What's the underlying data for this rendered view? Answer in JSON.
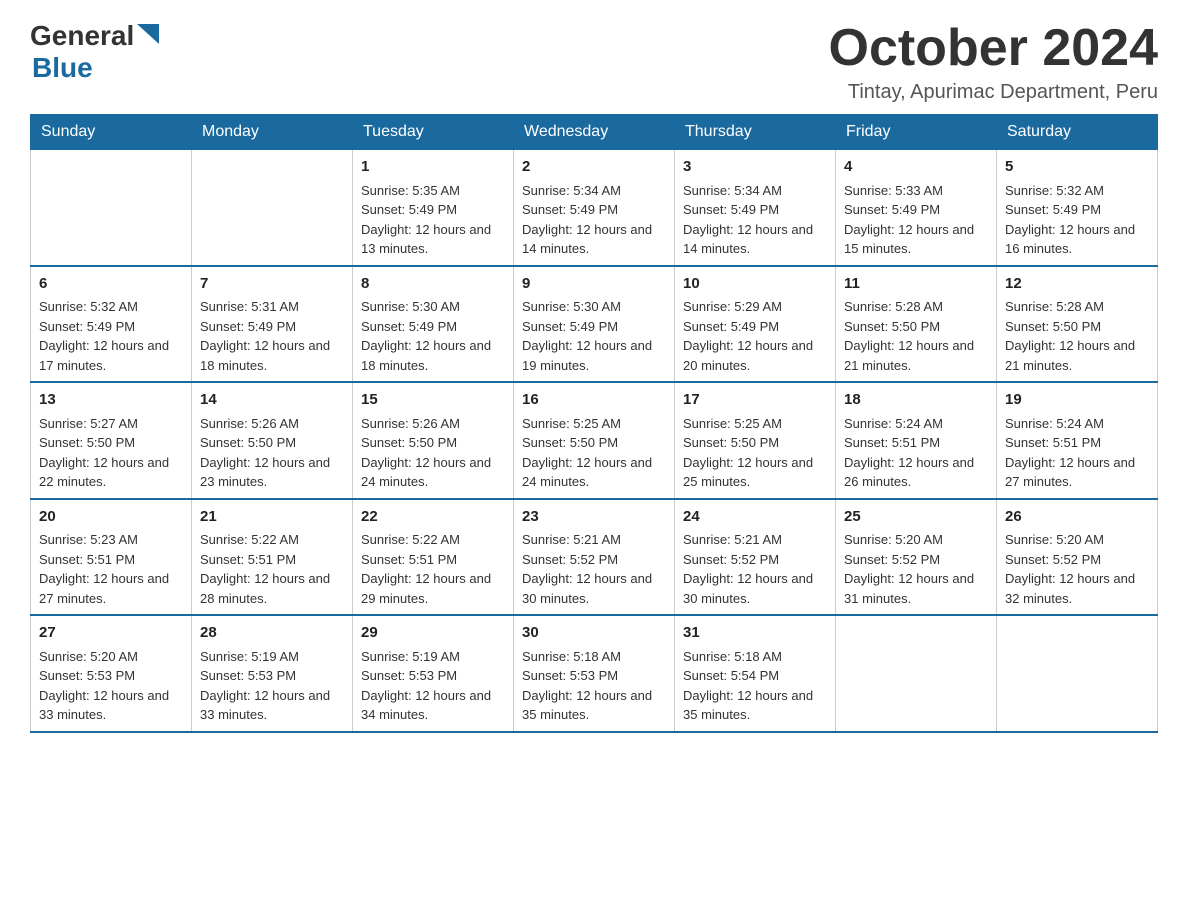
{
  "header": {
    "logo": {
      "general": "General",
      "blue": "Blue"
    },
    "title": "October 2024",
    "subtitle": "Tintay, Apurimac Department, Peru"
  },
  "weekdays": [
    "Sunday",
    "Monday",
    "Tuesday",
    "Wednesday",
    "Thursday",
    "Friday",
    "Saturday"
  ],
  "weeks": [
    [
      {
        "day": "",
        "sunrise": "",
        "sunset": "",
        "daylight": ""
      },
      {
        "day": "",
        "sunrise": "",
        "sunset": "",
        "daylight": ""
      },
      {
        "day": "1",
        "sunrise": "Sunrise: 5:35 AM",
        "sunset": "Sunset: 5:49 PM",
        "daylight": "Daylight: 12 hours and 13 minutes."
      },
      {
        "day": "2",
        "sunrise": "Sunrise: 5:34 AM",
        "sunset": "Sunset: 5:49 PM",
        "daylight": "Daylight: 12 hours and 14 minutes."
      },
      {
        "day": "3",
        "sunrise": "Sunrise: 5:34 AM",
        "sunset": "Sunset: 5:49 PM",
        "daylight": "Daylight: 12 hours and 14 minutes."
      },
      {
        "day": "4",
        "sunrise": "Sunrise: 5:33 AM",
        "sunset": "Sunset: 5:49 PM",
        "daylight": "Daylight: 12 hours and 15 minutes."
      },
      {
        "day": "5",
        "sunrise": "Sunrise: 5:32 AM",
        "sunset": "Sunset: 5:49 PM",
        "daylight": "Daylight: 12 hours and 16 minutes."
      }
    ],
    [
      {
        "day": "6",
        "sunrise": "Sunrise: 5:32 AM",
        "sunset": "Sunset: 5:49 PM",
        "daylight": "Daylight: 12 hours and 17 minutes."
      },
      {
        "day": "7",
        "sunrise": "Sunrise: 5:31 AM",
        "sunset": "Sunset: 5:49 PM",
        "daylight": "Daylight: 12 hours and 18 minutes."
      },
      {
        "day": "8",
        "sunrise": "Sunrise: 5:30 AM",
        "sunset": "Sunset: 5:49 PM",
        "daylight": "Daylight: 12 hours and 18 minutes."
      },
      {
        "day": "9",
        "sunrise": "Sunrise: 5:30 AM",
        "sunset": "Sunset: 5:49 PM",
        "daylight": "Daylight: 12 hours and 19 minutes."
      },
      {
        "day": "10",
        "sunrise": "Sunrise: 5:29 AM",
        "sunset": "Sunset: 5:49 PM",
        "daylight": "Daylight: 12 hours and 20 minutes."
      },
      {
        "day": "11",
        "sunrise": "Sunrise: 5:28 AM",
        "sunset": "Sunset: 5:50 PM",
        "daylight": "Daylight: 12 hours and 21 minutes."
      },
      {
        "day": "12",
        "sunrise": "Sunrise: 5:28 AM",
        "sunset": "Sunset: 5:50 PM",
        "daylight": "Daylight: 12 hours and 21 minutes."
      }
    ],
    [
      {
        "day": "13",
        "sunrise": "Sunrise: 5:27 AM",
        "sunset": "Sunset: 5:50 PM",
        "daylight": "Daylight: 12 hours and 22 minutes."
      },
      {
        "day": "14",
        "sunrise": "Sunrise: 5:26 AM",
        "sunset": "Sunset: 5:50 PM",
        "daylight": "Daylight: 12 hours and 23 minutes."
      },
      {
        "day": "15",
        "sunrise": "Sunrise: 5:26 AM",
        "sunset": "Sunset: 5:50 PM",
        "daylight": "Daylight: 12 hours and 24 minutes."
      },
      {
        "day": "16",
        "sunrise": "Sunrise: 5:25 AM",
        "sunset": "Sunset: 5:50 PM",
        "daylight": "Daylight: 12 hours and 24 minutes."
      },
      {
        "day": "17",
        "sunrise": "Sunrise: 5:25 AM",
        "sunset": "Sunset: 5:50 PM",
        "daylight": "Daylight: 12 hours and 25 minutes."
      },
      {
        "day": "18",
        "sunrise": "Sunrise: 5:24 AM",
        "sunset": "Sunset: 5:51 PM",
        "daylight": "Daylight: 12 hours and 26 minutes."
      },
      {
        "day": "19",
        "sunrise": "Sunrise: 5:24 AM",
        "sunset": "Sunset: 5:51 PM",
        "daylight": "Daylight: 12 hours and 27 minutes."
      }
    ],
    [
      {
        "day": "20",
        "sunrise": "Sunrise: 5:23 AM",
        "sunset": "Sunset: 5:51 PM",
        "daylight": "Daylight: 12 hours and 27 minutes."
      },
      {
        "day": "21",
        "sunrise": "Sunrise: 5:22 AM",
        "sunset": "Sunset: 5:51 PM",
        "daylight": "Daylight: 12 hours and 28 minutes."
      },
      {
        "day": "22",
        "sunrise": "Sunrise: 5:22 AM",
        "sunset": "Sunset: 5:51 PM",
        "daylight": "Daylight: 12 hours and 29 minutes."
      },
      {
        "day": "23",
        "sunrise": "Sunrise: 5:21 AM",
        "sunset": "Sunset: 5:52 PM",
        "daylight": "Daylight: 12 hours and 30 minutes."
      },
      {
        "day": "24",
        "sunrise": "Sunrise: 5:21 AM",
        "sunset": "Sunset: 5:52 PM",
        "daylight": "Daylight: 12 hours and 30 minutes."
      },
      {
        "day": "25",
        "sunrise": "Sunrise: 5:20 AM",
        "sunset": "Sunset: 5:52 PM",
        "daylight": "Daylight: 12 hours and 31 minutes."
      },
      {
        "day": "26",
        "sunrise": "Sunrise: 5:20 AM",
        "sunset": "Sunset: 5:52 PM",
        "daylight": "Daylight: 12 hours and 32 minutes."
      }
    ],
    [
      {
        "day": "27",
        "sunrise": "Sunrise: 5:20 AM",
        "sunset": "Sunset: 5:53 PM",
        "daylight": "Daylight: 12 hours and 33 minutes."
      },
      {
        "day": "28",
        "sunrise": "Sunrise: 5:19 AM",
        "sunset": "Sunset: 5:53 PM",
        "daylight": "Daylight: 12 hours and 33 minutes."
      },
      {
        "day": "29",
        "sunrise": "Sunrise: 5:19 AM",
        "sunset": "Sunset: 5:53 PM",
        "daylight": "Daylight: 12 hours and 34 minutes."
      },
      {
        "day": "30",
        "sunrise": "Sunrise: 5:18 AM",
        "sunset": "Sunset: 5:53 PM",
        "daylight": "Daylight: 12 hours and 35 minutes."
      },
      {
        "day": "31",
        "sunrise": "Sunrise: 5:18 AM",
        "sunset": "Sunset: 5:54 PM",
        "daylight": "Daylight: 12 hours and 35 minutes."
      },
      {
        "day": "",
        "sunrise": "",
        "sunset": "",
        "daylight": ""
      },
      {
        "day": "",
        "sunrise": "",
        "sunset": "",
        "daylight": ""
      }
    ]
  ]
}
